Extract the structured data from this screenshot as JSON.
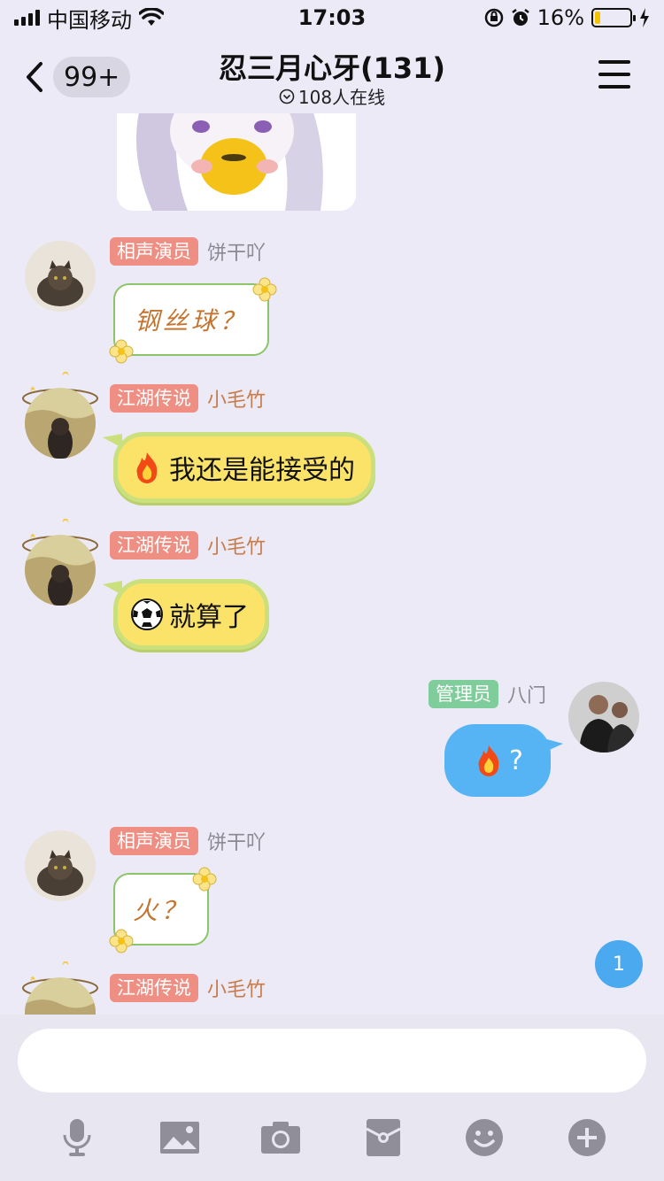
{
  "status_bar": {
    "carrier": "中国移动",
    "time": "17:03",
    "battery": "16%",
    "battery_level": 0.16,
    "signal_icon": "signal-icon",
    "wifi_icon": "wifi-icon",
    "rotation_lock_icon": "rotation-lock-icon",
    "alarm_icon": "alarm-icon",
    "charging_icon": "charging-icon"
  },
  "header": {
    "back_icon": "chevron-left-icon",
    "unread_count": "99+",
    "title": "忍三月心牙(131)",
    "online": "108人在线",
    "menu_icon": "hamburger-icon"
  },
  "messages": [
    {
      "role": "相声演员",
      "name": "饼干吖",
      "text": "钢丝球？",
      "style": "flower"
    },
    {
      "role": "江湖传说",
      "name": "小毛竹",
      "emoji": "fire",
      "text": "我还是能接受的",
      "style": "lemon"
    },
    {
      "role": "江湖传说",
      "name": "小毛竹",
      "emoji": "soccer-ball",
      "text": "就算了",
      "style": "lemon"
    },
    {
      "role": "管理员",
      "name": "八门",
      "emoji": "fire",
      "text": "?",
      "style": "blue"
    },
    {
      "role": "相声演员",
      "name": "饼干吖",
      "text": "火？",
      "style": "flower"
    },
    {
      "role": "江湖传说",
      "name": "小毛竹"
    }
  ],
  "new_message_count": "1",
  "input": {
    "placeholder": ""
  },
  "toolbar": [
    "microphone-icon",
    "image-icon",
    "camera-icon",
    "red-packet-icon",
    "emoji-icon",
    "plus-icon"
  ],
  "colors": {
    "background": "#eceaf6",
    "tag_red": "#ef8f84",
    "tag_green": "#7fcd9b",
    "blue_bubble": "#56b4f5",
    "lemon_bubble": "#fbe36a"
  }
}
